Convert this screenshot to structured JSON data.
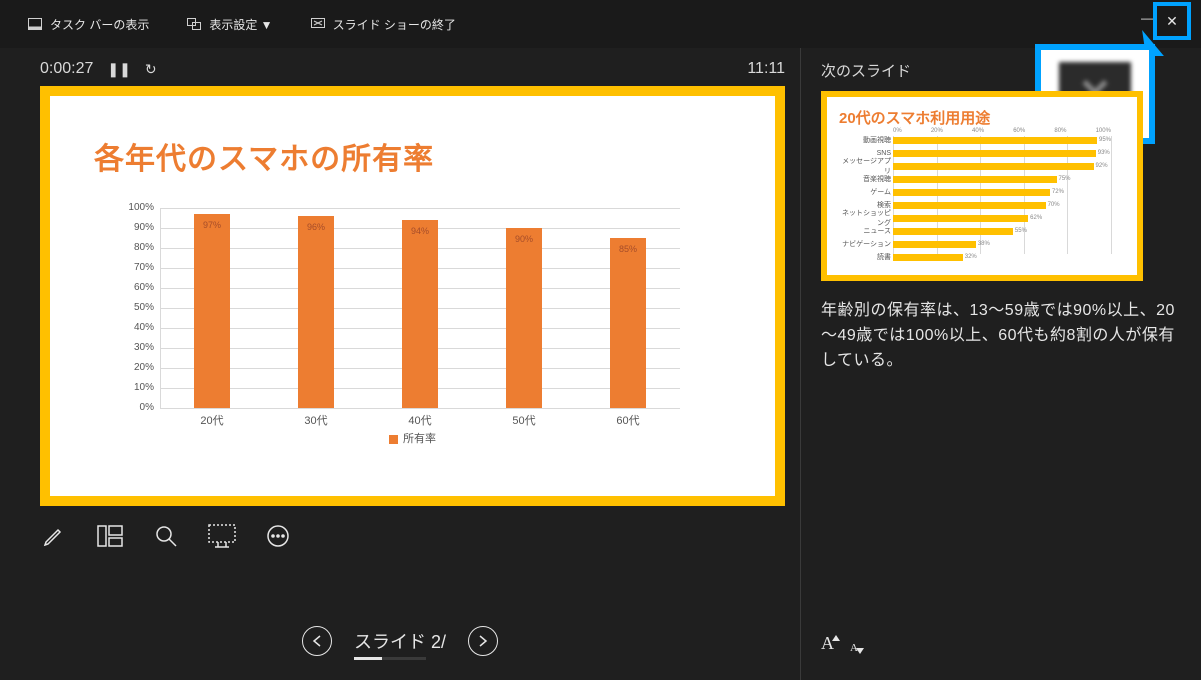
{
  "toolbar": {
    "taskbar": "タスク バーの表示",
    "display": "表示設定 ▼",
    "end_show": "スライド ショーの終了"
  },
  "timer": {
    "elapsed": "0:00:27",
    "clock": "11:11"
  },
  "current_slide": {
    "title": "各年代のスマホの所有率",
    "legend": "所有率"
  },
  "next_slide": {
    "header": "次のスライド",
    "title": "20代のスマホ利用用途"
  },
  "notes": "年齢別の保有率は、13～59歳では90%以上、20～49歳では100%以上、60代も約8割の人が保有している。",
  "nav": {
    "current_label": "スライド 2/"
  },
  "font": {
    "big": "A",
    "small": "A"
  },
  "chart_data": [
    {
      "type": "bar",
      "title": "各年代のスマホの所有率",
      "categories": [
        "20代",
        "30代",
        "40代",
        "50代",
        "60代"
      ],
      "values": [
        97,
        96,
        94,
        90,
        85
      ],
      "ylabel": "",
      "ylim": [
        0,
        100
      ],
      "yticks": [
        "0%",
        "10%",
        "20%",
        "30%",
        "40%",
        "50%",
        "60%",
        "70%",
        "80%",
        "90%",
        "100%"
      ],
      "legend": "所有率"
    },
    {
      "type": "bar-horizontal",
      "title": "20代のスマホ利用用途",
      "categories": [
        "動画視聴",
        "SNS",
        "メッセージアプリ",
        "音楽視聴",
        "ゲーム",
        "検索",
        "ネットショッピング",
        "ニュース",
        "ナビゲーション",
        "読書"
      ],
      "values": [
        95,
        93,
        92,
        75,
        72,
        70,
        62,
        55,
        38,
        32
      ],
      "xlim": [
        0,
        100
      ],
      "xticks": [
        "0%",
        "20%",
        "40%",
        "60%",
        "80%",
        "100%"
      ]
    }
  ]
}
